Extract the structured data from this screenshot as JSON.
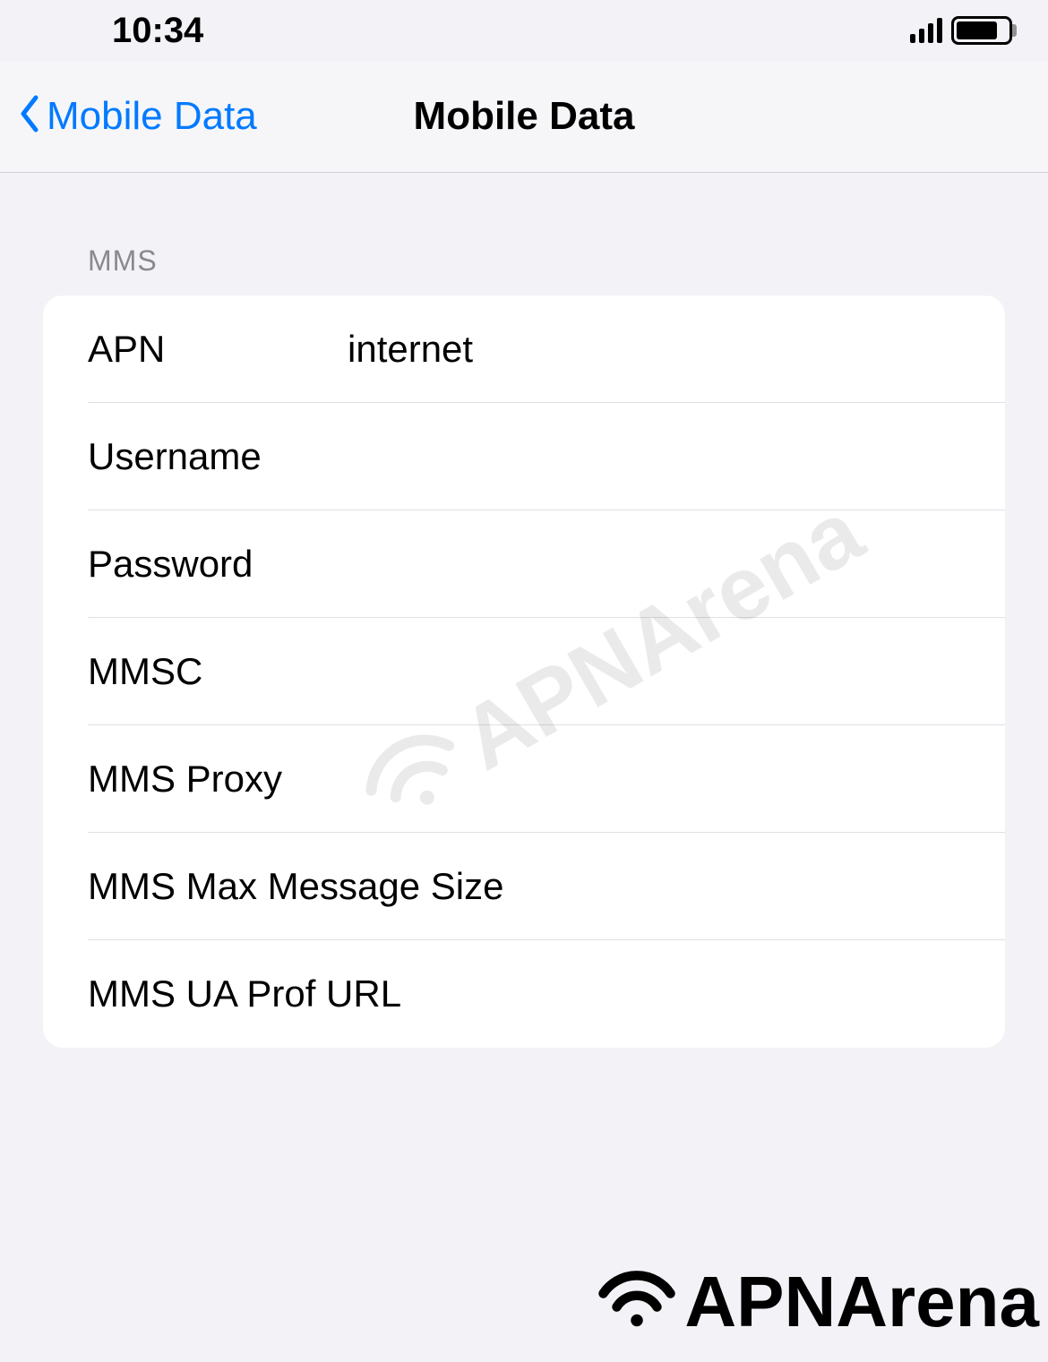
{
  "statusbar": {
    "time": "10:34"
  },
  "nav": {
    "back_label": "Mobile Data",
    "title": "Mobile Data"
  },
  "section": {
    "header": "MMS"
  },
  "fields": {
    "apn": {
      "label": "APN",
      "value": "internet"
    },
    "username": {
      "label": "Username",
      "value": ""
    },
    "password": {
      "label": "Password",
      "value": ""
    },
    "mmsc": {
      "label": "MMSC",
      "value": ""
    },
    "mms_proxy": {
      "label": "MMS Proxy",
      "value": ""
    },
    "mms_max_size": {
      "label": "MMS Max Message Size",
      "value": ""
    },
    "mms_ua_prof": {
      "label": "MMS UA Prof URL",
      "value": ""
    }
  },
  "watermark": {
    "text": "APNArena"
  }
}
